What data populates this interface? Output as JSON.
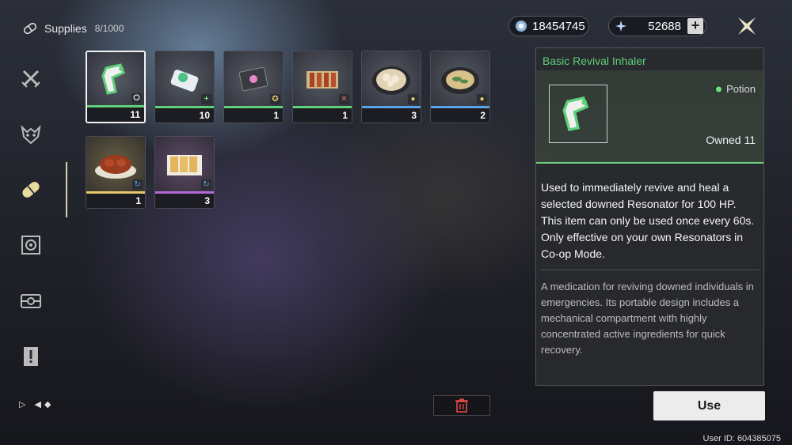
{
  "header": {
    "section_label": "Supplies",
    "capacity": "8/1000",
    "section_icon": "pill-icon"
  },
  "currencies": [
    {
      "icon": "shell-credit-icon",
      "value": "18454745"
    },
    {
      "icon": "astrite-icon",
      "value": "52688",
      "add_label": "+"
    }
  ],
  "sidebar": {
    "items": [
      {
        "name": "weapon-tab",
        "icon": "crossed-swords-icon"
      },
      {
        "name": "echo-tab",
        "icon": "demon-mask-icon"
      },
      {
        "name": "supplies-tab",
        "icon": "pill-icon",
        "active": true
      },
      {
        "name": "development-tab",
        "icon": "gear-target-icon"
      },
      {
        "name": "resources-tab",
        "icon": "box-icon"
      },
      {
        "name": "quest-items-tab",
        "icon": "exclamation-icon"
      }
    ],
    "footer_text": "▷ ◀◆"
  },
  "items": [
    {
      "name": "basic-revival-inhaler",
      "qty": "11",
      "bar_color": "#5fd17a",
      "badge": "potion-icon",
      "selected": true
    },
    {
      "name": "healing-kit",
      "qty": "10",
      "bar_color": "#5fd17a",
      "badge": "plus-icon"
    },
    {
      "name": "sticker-item",
      "qty": "1",
      "bar_color": "#5fd17a",
      "badge": "medal-icon"
    },
    {
      "name": "skewers",
      "qty": "1",
      "bar_color": "#5fd17a",
      "badge": "cross-icon"
    },
    {
      "name": "dumpling-dish",
      "qty": "3",
      "bar_color": "#5aa4e6",
      "badge": "person-icon"
    },
    {
      "name": "soup-dish",
      "qty": "2",
      "bar_color": "#5aa4e6",
      "badge": "person-icon"
    },
    {
      "name": "roast-chicken",
      "qty": "1",
      "bar_color": "#e3c96a",
      "badge": "cycle-icon"
    },
    {
      "name": "fried-snack",
      "qty": "3",
      "bar_color": "#b36ad8",
      "badge": "cycle-icon"
    }
  ],
  "detail": {
    "title": "Basic Revival Inhaler",
    "type_label": "Potion",
    "owned": "Owned 11",
    "description": "Used to immediately revive and heal a selected downed Resonator for 100 HP. This item can only be used once every 60s. Only effective on your own Resonators in Co-op Mode.",
    "lore": "A medication for reviving downed individuals in emergencies. Its portable design includes a mechanical compartment with highly concentrated active ingredients for quick recovery."
  },
  "actions": {
    "use_label": "Use",
    "delete_icon": "trash-icon"
  },
  "footer": {
    "user_id": "User ID: 604385075"
  },
  "colors": {
    "accent_green": "#5fd17a",
    "accent_blue": "#5aa4e6",
    "accent_gold": "#e3c96a",
    "accent_purple": "#b36ad8"
  }
}
